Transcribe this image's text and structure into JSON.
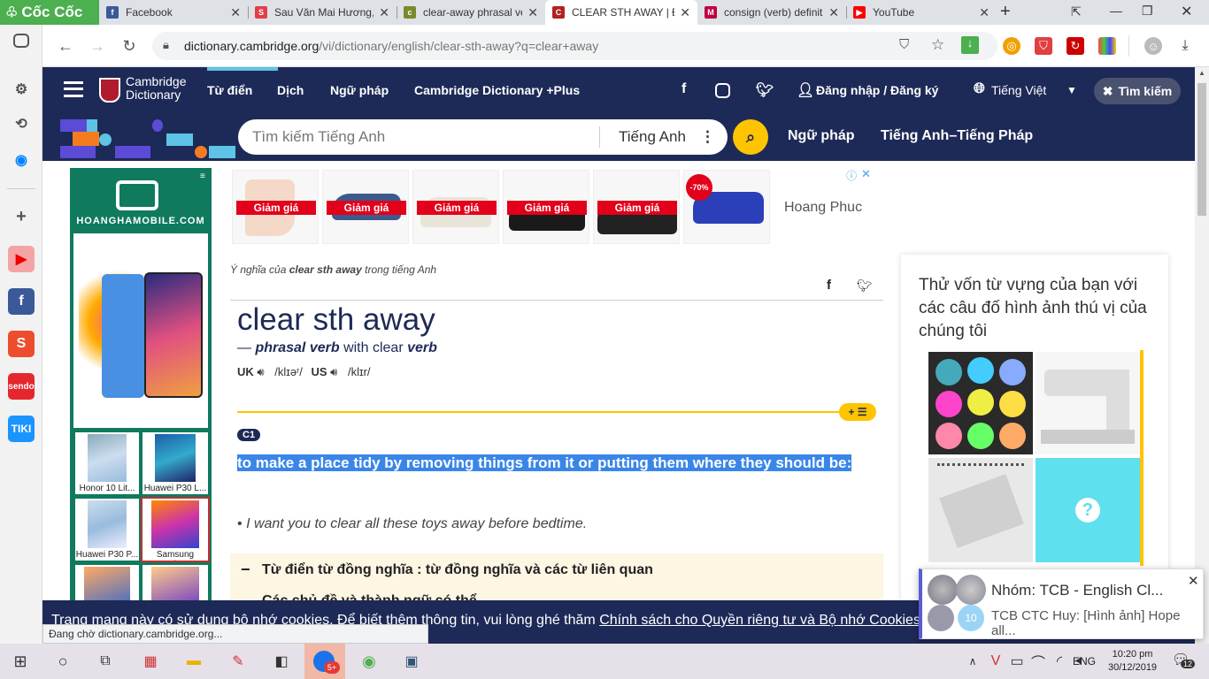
{
  "browser": {
    "brand": "Cốc Cốc",
    "tabs": [
      {
        "label": "Facebook",
        "icon": "facebook-icon",
        "color": "#3b5998",
        "glyph": "f"
      },
      {
        "label": "Sau Văn Mai Hương, ...",
        "icon": "image-site-icon",
        "color": "#e0404a",
        "glyph": "S"
      },
      {
        "label": "clear-away phrasal ve...",
        "icon": "leaf-site-icon",
        "color": "#7a8a2a",
        "glyph": "c"
      },
      {
        "label": "CLEAR STH AWAY | Đ...",
        "icon": "cambridge-icon",
        "color": "#b22222",
        "glyph": "C"
      },
      {
        "label": "consign (verb) definit...",
        "icon": "dictionary-site-icon",
        "color": "#c00040",
        "glyph": "M"
      },
      {
        "label": "YouTube",
        "icon": "youtube-icon",
        "color": "#ff0000",
        "glyph": "▶"
      }
    ],
    "url_host": "dictionary.cambridge.org",
    "url_path": "/vi/dictionary/english/clear-sth-away?q=clear+away",
    "status_text": "Đang chờ dictionary.cambridge.org..."
  },
  "site": {
    "logo_line1": "Cambridge",
    "logo_line2": "Dictionary",
    "nav": [
      "Từ điển",
      "Dịch",
      "Ngữ pháp",
      "Cambridge Dictionary +Plus"
    ],
    "login": "Đăng nhập / Đăng ký",
    "language": "Tiếng Việt",
    "search_toggle": "Tìm kiếm",
    "search_placeholder": "Tìm kiếm Tiếng Anh",
    "search_lang": "Tiếng Anh",
    "sub_nav": [
      "Ngữ pháp",
      "Tiếng Anh–Tiếng Pháp"
    ]
  },
  "left_ad": {
    "brand": "HOANGHAMOBILE.COM",
    "phones": [
      "Honor 10 Lit...",
      "Huawei P30 L...",
      "Huawei P30 P...",
      "Samsung Gala..."
    ]
  },
  "shoe_ad": {
    "sale_label": "Giảm giá",
    "discount": "-70%",
    "brand": "Hoang Phuc"
  },
  "entry": {
    "meaning_prefix": "Ý nghĩa của",
    "meaning_word": "clear sth away",
    "meaning_suffix": "trong tiếng Anh",
    "headword": "clear sth away",
    "pos_dash": "—",
    "pos": "phrasal verb",
    "pos_with": "with clear",
    "pos_verb": "verb",
    "uk_label": "UK",
    "uk_pron": "/klɪəʳ/",
    "us_label": "US",
    "us_pron": "/klɪr/",
    "level": "C1",
    "definition": "to make a place tidy by removing things from it or putting them where they should be:",
    "example": "I want you to clear all these toys away before bedtime.",
    "thesaurus": "Từ điển từ đồng nghĩa : từ đồng nghĩa và các từ liên quan",
    "thesaurus_next": "Các chủ đề và thành ngữ có thể..."
  },
  "quiz": {
    "title": "Thử vốn từ vựng của bạn với các câu đố hình ảnh thú vị của chúng tôi",
    "unknown": "?"
  },
  "cookie": {
    "text": "Trang mạng này có sử dụng bộ nhớ cookies. Để biết thêm thông tin, vui lòng ghé thăm",
    "link": "Chính sách cho Quyền riêng tư và Bộ nhớ Cookies"
  },
  "notification": {
    "title": "Nhóm: TCB - English Cl...",
    "body": "TCB CTC Huy: [Hình ảnh] Hope all...",
    "count": "10"
  },
  "taskbar": {
    "lang": "ENG",
    "time": "10:20 pm",
    "date": "30/12/2019",
    "badge": "5+",
    "notif_count": "12"
  }
}
